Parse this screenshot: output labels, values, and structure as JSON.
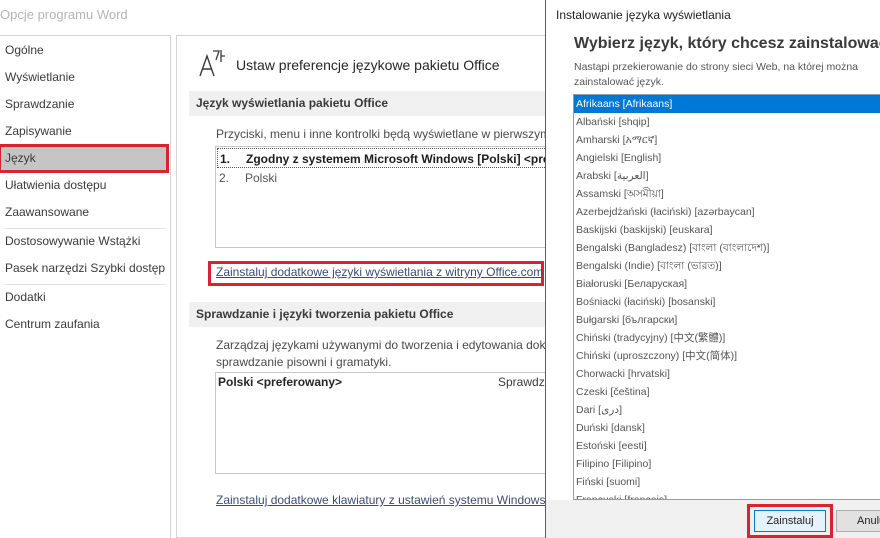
{
  "window": {
    "title": "Opcje programu Word"
  },
  "nav": {
    "items": [
      {
        "label": "Ogólne"
      },
      {
        "label": "Wyświetlanie"
      },
      {
        "label": "Sprawdzanie"
      },
      {
        "label": "Zapisywanie"
      },
      {
        "label": "Język",
        "selected": true
      },
      {
        "label": "Ułatwienia dostępu"
      },
      {
        "label": "Zaawansowane"
      },
      {
        "label": "Dostosowywanie Wstążki"
      },
      {
        "label": "Pasek narzędzi Szybki dostęp"
      },
      {
        "label": "Dodatki"
      },
      {
        "label": "Centrum zaufania"
      }
    ]
  },
  "main": {
    "header": "Ustaw preferencje językowe pakietu Office",
    "display": {
      "section_title": "Język wyświetlania pakietu Office",
      "description": "Przyciski, menu i inne kontrolki będą wyświetlane w pierwszym",
      "items": [
        {
          "num": "1.",
          "label": "Zgodny z systemem Microsoft Windows [Polski] <preferowany>"
        },
        {
          "num": "2.",
          "label": "Polski"
        }
      ],
      "install_link": "Zainstaluj dodatkowe języki wyświetlania z witryny Office.com"
    },
    "authoring": {
      "section_title": "Sprawdzanie i języki tworzenia pakietu Office",
      "description_line1": "Zarządzaj językami używanymi do tworzenia i edytowania dokumentów,",
      "description_line2": "sprawdzanie pisowni i gramatyki.",
      "list_item": "Polski <preferowany>",
      "list_col": "Sprawdzanie",
      "keyboard_link": "Zainstaluj dodatkowe klawiatury z ustawień systemu Windows"
    }
  },
  "dialog": {
    "title": "Instalowanie języka wyświetlania",
    "heading": "Wybierz język, który chcesz zainstalować.",
    "note": "Nastąpi przekierowanie do strony sieci Web, na której można zainstalować język.",
    "languages": [
      "Afrikaans [Afrikaans]",
      "Albański [shqip]",
      "Amharski [አማርኛ]",
      "Angielski [English]",
      "Arabski [العربية]",
      "Assamski [অসমীয়া]",
      "Azerbejdżański (łaciński) [azərbaycan]",
      "Baskijski (baskijski) [euskara]",
      "Bengalski (Bangladesz) [বাংলা (বাংলাদেশ)]",
      "Bengalski (Indie) [বাংলা (ভারত)]",
      "Białoruski [Беларуская]",
      "Bośniacki (łaciński) [bosanski]",
      "Bułgarski [български]",
      "Chiński (tradycyjny) [中文(繁體)]",
      "Chiński (uproszczony) [中文(简体)]",
      "Chorwacki [hrvatski]",
      "Czeski [čeština]",
      "Dari [دری]",
      "Duński [dansk]",
      "Estoński [eesti]",
      "Filipino [Filipino]",
      "Fiński [suomi]",
      "Francuski [français]"
    ],
    "selected_language": "Afrikaans [Afrikaans]",
    "install_button": "Zainstaluj",
    "cancel_button": "Anuluj",
    "accent_color": "#0078d7",
    "highlight_color": "#d9232e"
  }
}
